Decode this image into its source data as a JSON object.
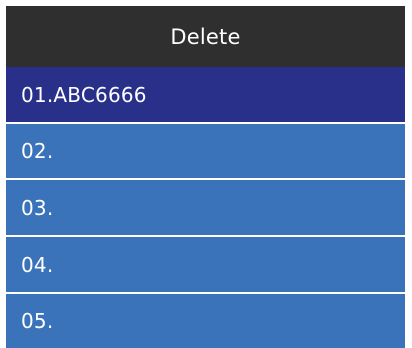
{
  "header": {
    "title": "Delete"
  },
  "list": {
    "items": [
      {
        "label": "01.ABC6666",
        "selected": true
      },
      {
        "label": "02.",
        "selected": false
      },
      {
        "label": "03.",
        "selected": false
      },
      {
        "label": "04.",
        "selected": false
      },
      {
        "label": "05.",
        "selected": false
      }
    ]
  },
  "colors": {
    "header_bg": "#2f2f2f",
    "item_bg": "#3a73b9",
    "selected_bg": "#28308a",
    "divider": "#ffffff",
    "text": "#ffffff"
  }
}
